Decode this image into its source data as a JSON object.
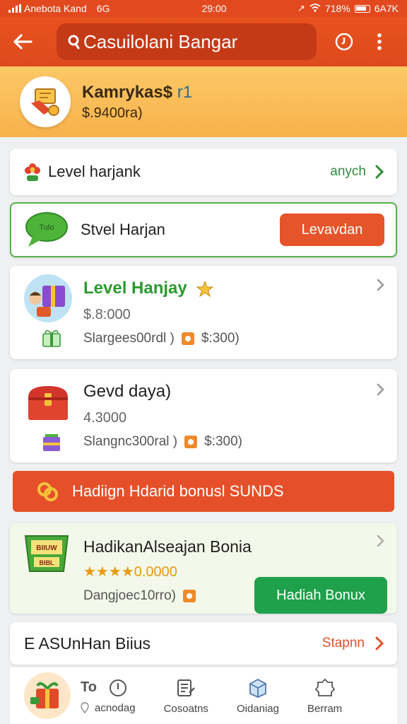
{
  "status": {
    "carrier": "Anebota Kand",
    "network": "6G",
    "time": "29:00",
    "battery": "718%",
    "extra": "6A7K"
  },
  "header": {
    "search_text": "Casuilolani Bangar"
  },
  "banner": {
    "title": "Kamrykas$",
    "title_tail": "r1",
    "subtitle": "$.9400ra)"
  },
  "level_row": {
    "label": "Level harjank",
    "link": "anych"
  },
  "chat_row": {
    "label": "Stvel Harjan",
    "button": "Levavdan",
    "bubble_text": "Tulo"
  },
  "products": [
    {
      "title": "Level Hanjay",
      "price": "$.8:000",
      "meta_left": "Slargees00rdl )",
      "meta_right": "$:300)"
    },
    {
      "title": "Gevd daya)",
      "price": "4.3000",
      "meta_left": "Slangnc300ral )",
      "meta_right": "$:300)"
    }
  ],
  "bonus_strip": {
    "label": "Hadiign Hdarid bonusl SUNDS"
  },
  "bonus_card": {
    "title": "HadikanAlseajan Bonia",
    "rating_value": "0.0000",
    "stars": 4,
    "meta": "Dangjoec10rro)",
    "button": "Hadiah Bonux",
    "badge_top": "BIIUW",
    "badge_bottom": "BIBL"
  },
  "footer_row": {
    "label": "E ASUnHan Biius",
    "link": "Stapnn"
  },
  "bottom_nav": {
    "first_top": "To",
    "first_bottom": "acnodag",
    "items": [
      "Cosoatns",
      "Oidaniag",
      "Berram"
    ]
  },
  "colors": {
    "header": "#e2491f",
    "banner": "#f8b24b",
    "accent_orange": "#e5542a",
    "accent_green": "#1fa04a"
  }
}
